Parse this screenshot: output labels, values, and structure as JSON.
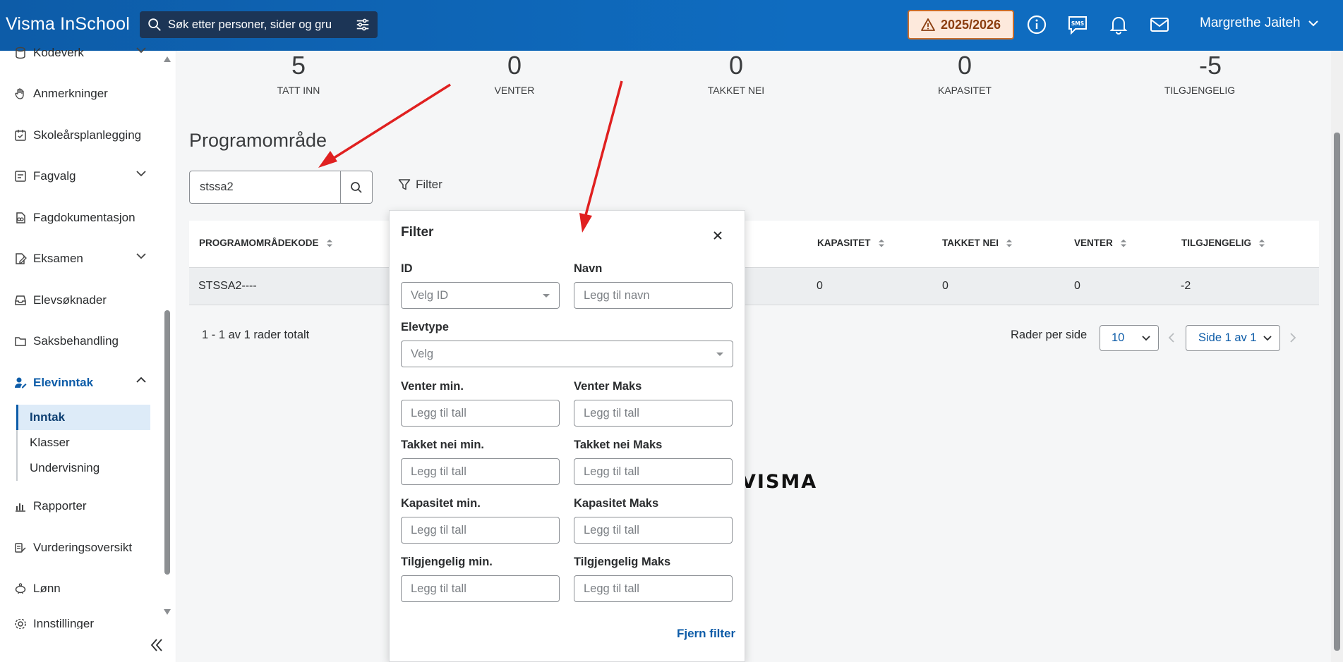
{
  "header": {
    "brand": "Visma InSchool",
    "search_placeholder": "Søk etter personer, sider og gru",
    "school_year": "2025/2026",
    "user_name": "Margrethe Jaiteh"
  },
  "sidebar": {
    "items": [
      {
        "label": "Kodeverk"
      },
      {
        "label": "Anmerkninger"
      },
      {
        "label": "Skoleårsplanlegging"
      },
      {
        "label": "Fagvalg"
      },
      {
        "label": "Fagdokumentasjon"
      },
      {
        "label": "Eksamen"
      },
      {
        "label": "Elevsøknader"
      },
      {
        "label": "Saksbehandling"
      },
      {
        "label": "Elevinntak"
      },
      {
        "label": "Rapporter"
      },
      {
        "label": "Vurderingsoversikt"
      },
      {
        "label": "Lønn"
      },
      {
        "label": "Innstillinger"
      }
    ],
    "subitems": [
      {
        "label": "Inntak"
      },
      {
        "label": "Klasser"
      },
      {
        "label": "Undervisning"
      }
    ]
  },
  "stats": [
    {
      "value": "5",
      "label": "TATT INN"
    },
    {
      "value": "0",
      "label": "VENTER"
    },
    {
      "value": "0",
      "label": "TAKKET NEI"
    },
    {
      "value": "0",
      "label": "KAPASITET"
    },
    {
      "value": "-5",
      "label": "TILGJENGELIG"
    }
  ],
  "section": {
    "title": "Programområde",
    "search_value": "stssa2",
    "filter_label": "Filter"
  },
  "table": {
    "headers": [
      "PROGRAMOMRÅDEKODE",
      "KAPASITET",
      "TAKKET NEI",
      "VENTER",
      "TILGJENGELIG"
    ],
    "rows": [
      {
        "code": "STSSA2----",
        "kapasitet": "0",
        "takket_nei": "0",
        "venter": "0",
        "tilgjengelig": "-2"
      }
    ]
  },
  "pagination": {
    "totals": "1 - 1 av 1 rader totalt",
    "rows_per_page_label": "Rader per side",
    "rows_per_page": "10",
    "page": "Side 1 av 1"
  },
  "footer_logo": "VISMA",
  "filter_panel": {
    "title": "Filter",
    "id_label": "ID",
    "id_placeholder": "Velg ID",
    "navn_label": "Navn",
    "navn_placeholder": "Legg til navn",
    "elevtype_label": "Elevtype",
    "elevtype_placeholder": "Velg",
    "venter_min_label": "Venter min.",
    "venter_max_label": "Venter Maks",
    "takket_min_label": "Takket nei min.",
    "takket_max_label": "Takket nei Maks",
    "kapasitet_min_label": "Kapasitet min.",
    "kapasitet_max_label": "Kapasitet Maks",
    "tilgj_min_label": "Tilgjengelig min.",
    "tilgj_max_label": "Tilgjengelig Maks",
    "number_placeholder": "Legg til tall",
    "clear_label": "Fjern filter"
  },
  "colors": {
    "header_blue": "#0f6cc0",
    "accent_blue": "#0d5ca8",
    "warning_bg": "#fde9dc",
    "warning_border": "#c76c2b",
    "annotation_red": "#e02020"
  }
}
